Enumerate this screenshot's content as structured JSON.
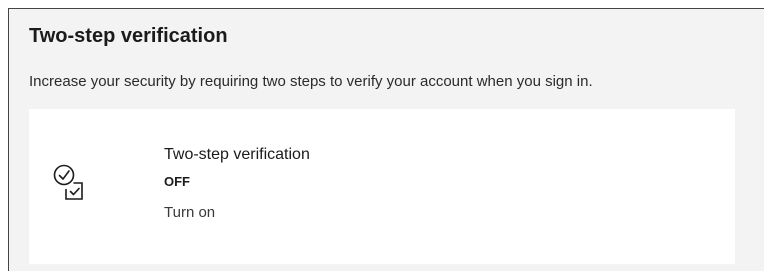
{
  "section": {
    "title": "Two-step verification",
    "description": "Increase your security by requiring two steps to verify your account when you sign in."
  },
  "card": {
    "icon": "two-step-verification-icon",
    "title": "Two-step verification",
    "status": "OFF",
    "action_label": "Turn on"
  }
}
